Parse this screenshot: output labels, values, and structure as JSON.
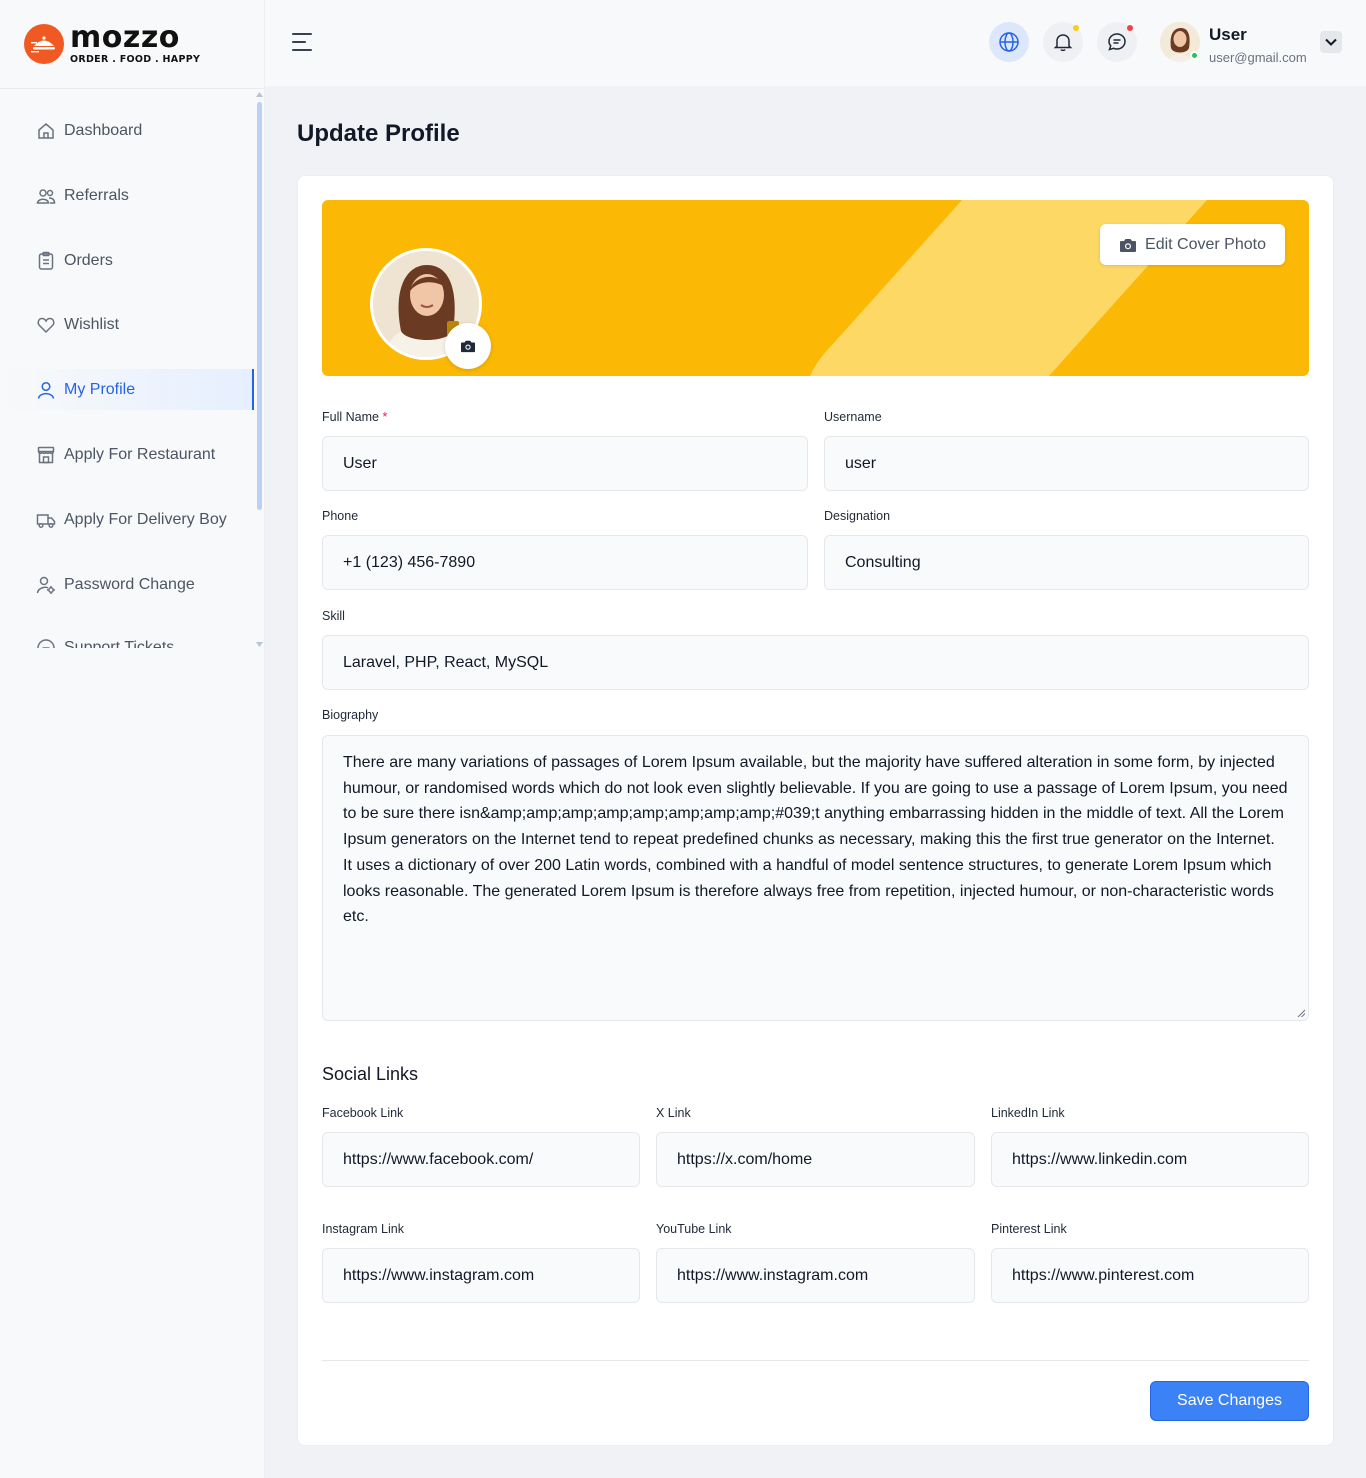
{
  "brand": {
    "name": "mozzo",
    "tagline": "ORDER . FOOD . HAPPY",
    "color": "#f05a22"
  },
  "sidebar": {
    "items": [
      {
        "label": "Dashboard",
        "icon": "home-icon",
        "active": false
      },
      {
        "label": "Referrals",
        "icon": "users-icon",
        "active": false
      },
      {
        "label": "Orders",
        "icon": "clipboard-icon",
        "active": false
      },
      {
        "label": "Wishlist",
        "icon": "heart-icon",
        "active": false
      },
      {
        "label": "My Profile",
        "icon": "user-icon",
        "active": true
      },
      {
        "label": "Apply For Restaurant",
        "icon": "store-icon",
        "active": false
      },
      {
        "label": "Apply For Delivery Boy",
        "icon": "truck-icon",
        "active": false
      },
      {
        "label": "Password Change",
        "icon": "user-gear-icon",
        "active": false
      },
      {
        "label": "Support Tickets",
        "icon": "support-icon",
        "active": false
      }
    ]
  },
  "header": {
    "user_name": "User",
    "user_email": "user@gmail.com",
    "notification_dot_color": "#facc15",
    "message_dot_color": "#ef4444"
  },
  "page": {
    "title": "Update Profile"
  },
  "cover": {
    "edit_label": "Edit Cover Photo",
    "color": "#fbb804",
    "stripe_color": "#fdd865"
  },
  "form": {
    "full_name": {
      "label": "Full Name",
      "required_mark": "*",
      "value": "User"
    },
    "username": {
      "label": "Username",
      "value": "user"
    },
    "phone": {
      "label": "Phone",
      "value": "+1 (123) 456-7890"
    },
    "designation": {
      "label": "Designation",
      "value": "Consulting"
    },
    "skill": {
      "label": "Skill",
      "value": "Laravel, PHP, React, MySQL"
    },
    "biography": {
      "label": "Biography",
      "value": "There are many variations of passages of Lorem Ipsum available, but the majority have suffered alteration in some form, by injected humour, or randomised words which do not look even slightly believable. If you are going to use a passage of Lorem Ipsum, you need to be sure there isn&amp;amp;amp;amp;amp;amp;amp;amp;#039;t anything embarrassing hidden in the middle of text. All the Lorem Ipsum generators on the Internet tend to repeat predefined chunks as necessary, making this the first true generator on the Internet. It uses a dictionary of over 200 Latin words, combined with a handful of model sentence structures, to generate Lorem Ipsum which looks reasonable. The generated Lorem Ipsum is therefore always free from repetition, injected humour, or non-characteristic words etc."
    }
  },
  "social": {
    "title": "Social Links",
    "facebook": {
      "label": "Facebook Link",
      "value": "https://www.facebook.com/"
    },
    "x": {
      "label": "X Link",
      "value": "https://x.com/home"
    },
    "linkedin": {
      "label": "LinkedIn Link",
      "value": "https://www.linkedin.com"
    },
    "instagram": {
      "label": "Instagram Link",
      "value": "https://www.instagram.com"
    },
    "youtube": {
      "label": "YouTube Link",
      "value": "https://www.instagram.com"
    },
    "pinterest": {
      "label": "Pinterest Link",
      "value": "https://www.pinterest.com"
    }
  },
  "actions": {
    "save_label": "Save Changes",
    "save_color": "#3b82f6"
  }
}
